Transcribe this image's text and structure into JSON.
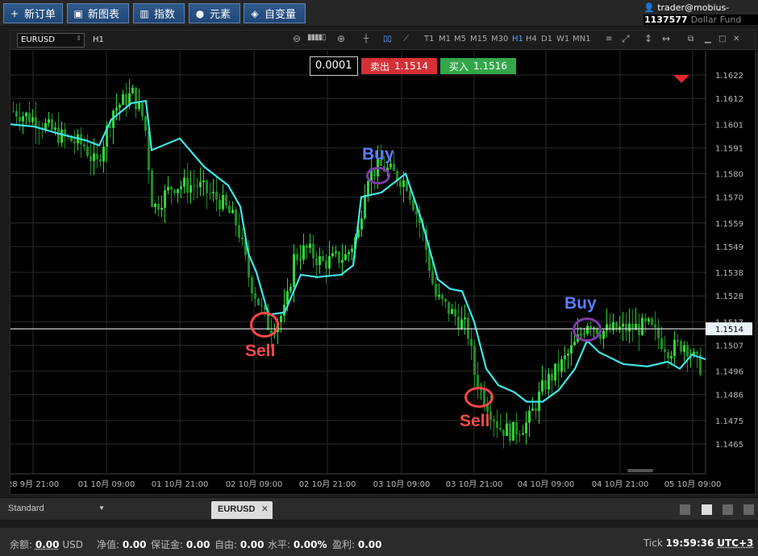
{
  "toolbar": {
    "new_order": "新订单",
    "new_chart": "新图表",
    "indicators": "指数",
    "elements": "元素",
    "variables": "自变量"
  },
  "account": {
    "user": "trader@mobius-soft.org",
    "number": "1137577",
    "fund": "Dollar Fund"
  },
  "chart_toolbar": {
    "symbol": "EURUSD",
    "timeframe": "H1",
    "timeframes": [
      "T1",
      "M1",
      "M5",
      "M15",
      "M30",
      "H1",
      "H4",
      "D1",
      "W1",
      "MN1"
    ],
    "active_timeframe": "H1"
  },
  "trade_panel": {
    "step": "0.0001",
    "sell_label": "卖出",
    "sell_price": "1.1514",
    "buy_label": "买入",
    "buy_price": "1.1516"
  },
  "chart_data": {
    "type": "candlestick",
    "symbol": "EURUSD",
    "timeframe": "H1",
    "current_price": 1.1514,
    "y_ticks": [
      "1.1622",
      "1.1612",
      "1.1601",
      "1.1591",
      "1.1580",
      "1.1570",
      "1.1559",
      "1.1549",
      "1.1538",
      "1.1528",
      "1.1517",
      "1.1507",
      "1.1496",
      "1.1486",
      "1.1475",
      "1.1465"
    ],
    "x_ticks": [
      "28 9月 21:00",
      "01 10月 09:00",
      "01 10月 21:00",
      "02 10月 09:00",
      "02 10月 21:00",
      "03 10月 09:00",
      "03 10月 21:00",
      "04 10月 09:00",
      "04 10月 21:00",
      "05 10月 09:00"
    ],
    "moving_average_color": "#3ee6e6",
    "bull_color": "#33d33a",
    "bear_color": "#1f8a26",
    "signals": [
      {
        "label": "Sell",
        "price": 1.1514
      },
      {
        "label": "Buy",
        "price": 1.1581
      },
      {
        "label": "Sell",
        "price": 1.1488
      },
      {
        "label": "Buy",
        "price": 1.1514
      }
    ]
  },
  "tabs": {
    "layout": "Standard",
    "chart_tab": "EURUSD",
    "close": "✕"
  },
  "status": {
    "balance_label": "余额:",
    "balance": "0.00",
    "currency": "USD",
    "equity_label": "净值:",
    "equity": "0.00",
    "margin_label": "保证金:",
    "margin": "0.00",
    "free_label": "自由:",
    "free": "0.00",
    "level_label": "水平:",
    "level": "0.00%",
    "profit_label": "盈利:",
    "profit": "0.00",
    "tick_label": "Tick",
    "time": "19:59:36",
    "timezone": "UTC+3"
  }
}
